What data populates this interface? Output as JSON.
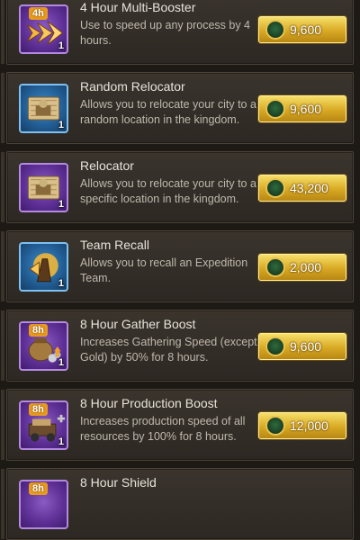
{
  "items": [
    {
      "title": "4 Hour Multi-Booster",
      "desc": "Use to speed up any process by 4 hours.",
      "price": "9,600",
      "qty": "1",
      "tag": "4h",
      "icon": "speed-arrows-icon"
    },
    {
      "title": "Random Relocator",
      "desc": "Allows you to relocate your city to a random location in the kingdom.",
      "price": "9,600",
      "qty": "1",
      "tag": "",
      "icon": "random-relocator-icon"
    },
    {
      "title": "Relocator",
      "desc": "Allows you to relocate your city to a specific location in the kingdom.",
      "price": "43,200",
      "qty": "1",
      "tag": "",
      "icon": "relocator-icon"
    },
    {
      "title": "Team Recall",
      "desc": "Allows you to recall an Expedition Team.",
      "price": "2,000",
      "qty": "1",
      "tag": "",
      "icon": "team-recall-icon"
    },
    {
      "title": "8 Hour Gather Boost",
      "desc": "Increases Gathering Speed (except Gold) by 50% for 8 hours.",
      "price": "9,600",
      "qty": "1",
      "tag": "8h",
      "icon": "gather-boost-icon"
    },
    {
      "title": "8 Hour Production Boost",
      "desc": "Increases production speed of all resources by 100% for 8 hours.",
      "price": "12,000",
      "qty": "1",
      "tag": "8h",
      "icon": "production-boost-icon"
    },
    {
      "title": "8 Hour Shield",
      "desc": "",
      "price": "",
      "qty": "",
      "tag": "8h",
      "icon": "shield-icon"
    }
  ],
  "colors": {
    "accent": "#e79a1d",
    "price_button": "#d8a924"
  }
}
